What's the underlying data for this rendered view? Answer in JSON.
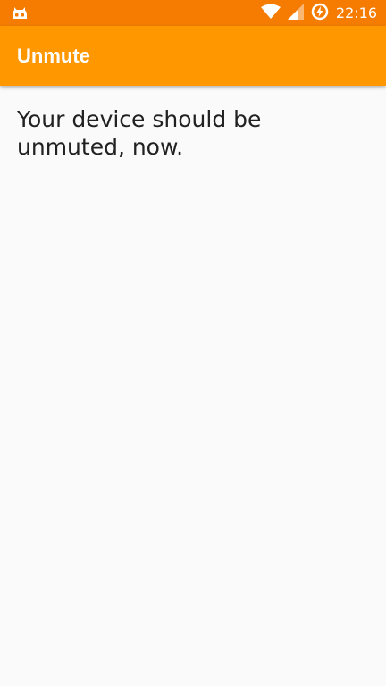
{
  "status_bar": {
    "time": "22:16",
    "icons": {
      "left": "cyanogenmod-icon",
      "wifi": "wifi-icon",
      "signal": "signal-icon",
      "battery": "battery-charging-icon"
    },
    "background": "#F57C00"
  },
  "app_bar": {
    "title": "Unmute",
    "background": "#FF9800"
  },
  "content": {
    "message": "Your device should be unmuted, now."
  }
}
